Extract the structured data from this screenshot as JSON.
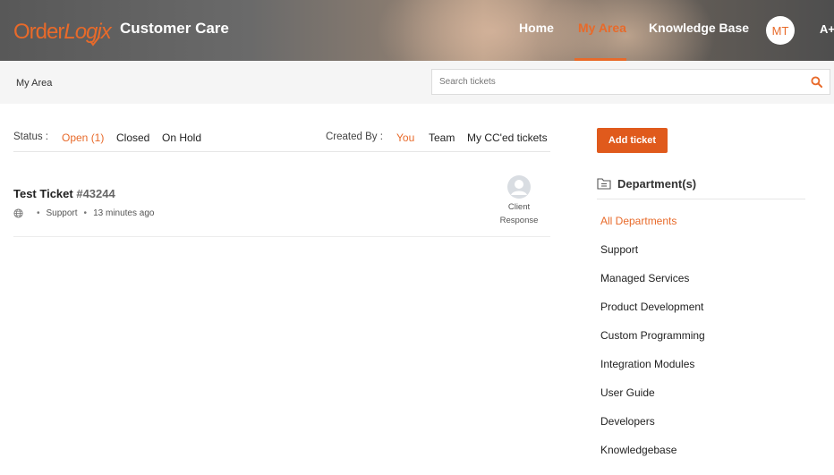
{
  "header": {
    "logo_order": "Order",
    "logo_logix": "Logix",
    "app_title": "Customer Care",
    "nav": [
      {
        "label": "Home",
        "active": false
      },
      {
        "label": "My Area",
        "active": true
      },
      {
        "label": "Knowledge Base",
        "active": false
      }
    ],
    "avatar_initials": "MT",
    "font_toggle": "A+"
  },
  "subbar": {
    "breadcrumb": "My Area",
    "search_placeholder": "Search tickets"
  },
  "filters": {
    "status_label": "Status :",
    "status_options": [
      "Open (1)",
      "Closed",
      "On Hold"
    ],
    "status_active": "Open (1)",
    "created_by_label": "Created By :",
    "created_by_options": [
      "You",
      "Team",
      "My CC'ed tickets"
    ],
    "created_by_active": "You"
  },
  "tickets": [
    {
      "title": "Test Ticket",
      "id": "#43244",
      "department": "Support",
      "time": "13 minutes ago",
      "status_line1": "Client",
      "status_line2": "Response"
    }
  ],
  "sidebar": {
    "add_ticket_label": "Add ticket",
    "departments_title": "Department(s)",
    "departments": [
      "All Departments",
      "Support",
      "Managed Services",
      "Product Development",
      "Custom Programming",
      "Integration Modules",
      "User Guide",
      "Developers",
      "Knowledgebase"
    ],
    "active_department": "All Departments"
  },
  "colors": {
    "accent": "#e86a2a",
    "button": "#e05a1c"
  },
  "icons": {
    "search": "search-icon",
    "globe": "globe-icon",
    "folder": "folder-icon",
    "user": "user-avatar-icon"
  }
}
